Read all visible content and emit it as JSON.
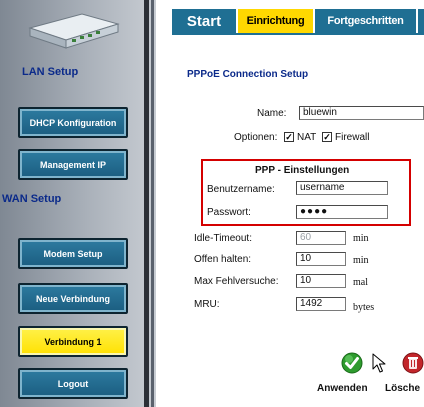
{
  "sidebar": {
    "lan_label": "LAN Setup",
    "wan_label": "WAN Setup",
    "buttons": [
      {
        "label": "DHCP Konfiguration",
        "active": false
      },
      {
        "label": "Management IP",
        "active": false
      },
      {
        "label": "Modem Setup",
        "active": false
      },
      {
        "label": "Neue Verbindung",
        "active": false
      },
      {
        "label": "Verbindung 1",
        "active": true
      },
      {
        "label": "Logout",
        "active": false
      }
    ]
  },
  "tabs": [
    {
      "label": "Start",
      "active": false
    },
    {
      "label": "Einrichtung",
      "active": true
    },
    {
      "label": "Fortgeschritten",
      "active": false
    }
  ],
  "form": {
    "title": "PPPoE Connection Setup",
    "name_label": "Name:",
    "name_value": "bluewin",
    "options_label": "Optionen:",
    "nat_label": "NAT",
    "nat_checked": true,
    "firewall_label": "Firewall",
    "firewall_checked": true,
    "ppp_header": "PPP - Einstellungen",
    "username_label": "Benutzername:",
    "username_value": "username",
    "password_label": "Passwort:",
    "password_value": "●●●●",
    "idle_label": "Idle-Timeout:",
    "idle_value": "60",
    "idle_unit": "min",
    "hold_label": "Offen halten:",
    "hold_value": "10",
    "hold_unit": "min",
    "retry_label": "Max Fehlversuche:",
    "retry_value": "10",
    "retry_unit": "mal",
    "mru_label": "MRU:",
    "mru_value": "1492",
    "mru_unit": "bytes"
  },
  "actions": {
    "apply_label": "Anwenden",
    "delete_label": "Lösche"
  },
  "colors": {
    "accent": "#1f6f93",
    "active": "#ffd800",
    "highlight_box": "#d40000",
    "heading": "#0b2a8a"
  },
  "icons": {
    "apply": "green-check-icon",
    "delete": "red-trash-icon",
    "router": "router-device-icon",
    "cursor": "mouse-pointer-icon"
  }
}
